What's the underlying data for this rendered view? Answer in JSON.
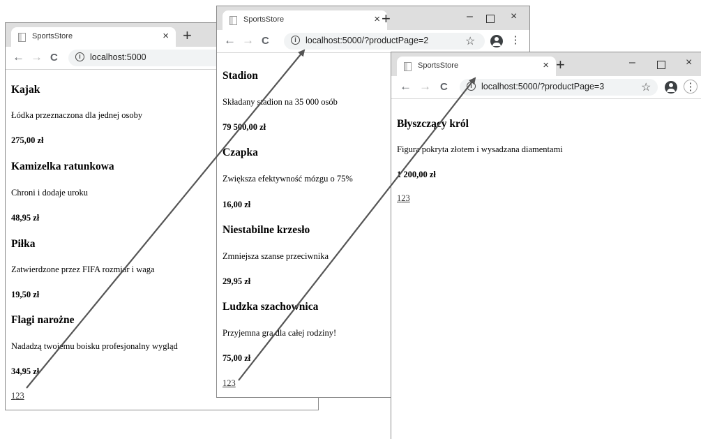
{
  "windows": [
    {
      "tab_title": "SportsStore",
      "close": "×",
      "newtab": "+",
      "url": "localhost:5000",
      "products": [
        {
          "name": "Kajak",
          "description": "Łódka przeznaczona dla jednej osoby",
          "price": "275,00 zł"
        },
        {
          "name": "Kamizelka ratunkowa",
          "description": "Chroni i dodaje uroku",
          "price": "48,95 zł"
        },
        {
          "name": "Piłka",
          "description": "Zatwierdzone przez FIFA rozmiar i waga",
          "price": "19,50 zł"
        },
        {
          "name": "Flagi narożne",
          "description": "Nadadzą twojemu boisku profesjonalny wygląd",
          "price": "34,95 zł"
        }
      ],
      "pages": [
        "1",
        "2",
        "3"
      ]
    },
    {
      "tab_title": "SportsStore",
      "close": "×",
      "newtab": "+",
      "controls": {
        "minimize": "–",
        "maximize": "",
        "close": "×"
      },
      "url": "localhost:5000/?productPage=2",
      "products": [
        {
          "name": "Stadion",
          "description": "Składany stadion na 35 000 osób",
          "price": "79 500,00 zł"
        },
        {
          "name": "Czapka",
          "description": "Zwiększa efektywność mózgu o 75%",
          "price": "16,00 zł"
        },
        {
          "name": "Niestabilne krzesło",
          "description": "Zmniejsza szanse przeciwnika",
          "price": "29,95 zł"
        },
        {
          "name": "Ludzka szachownica",
          "description": "Przyjemna gra dla całej rodziny!",
          "price": "75,00 zł"
        }
      ],
      "pages": [
        "1",
        "2",
        "3"
      ]
    },
    {
      "tab_title": "SportsStore",
      "close": "×",
      "newtab": "+",
      "controls": {
        "minimize": "–",
        "maximize": "",
        "close": "×"
      },
      "url": "localhost:5000/?productPage=3",
      "products": [
        {
          "name": "Błyszczący król",
          "description": "Figura pokryta złotem i wysadzana diamentami",
          "price": "1 200,00 zł"
        }
      ],
      "pages": [
        "1",
        "2",
        "3"
      ]
    }
  ],
  "icons": {
    "back": "←",
    "forward": "→",
    "reload": "C",
    "info": "i",
    "star": "☆",
    "menu": "⋮"
  },
  "annotation_color": "#555555"
}
